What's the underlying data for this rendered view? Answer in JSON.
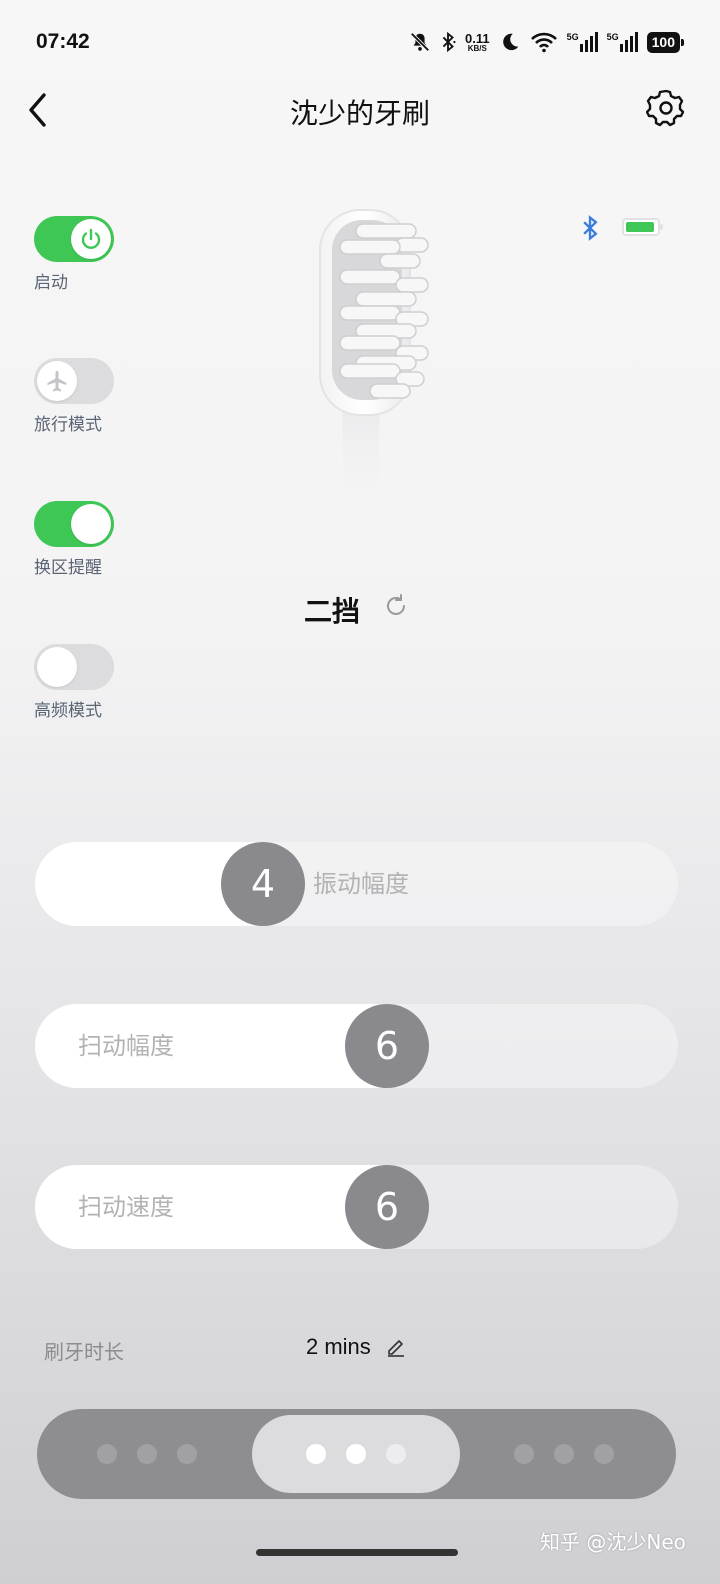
{
  "status_bar": {
    "time": "07:42",
    "net_speed_value": "0.11",
    "net_speed_unit": "KB/S",
    "sim1_label": "5G",
    "sim2_label": "5G",
    "battery": "100",
    "icons": [
      "mute-bell-icon",
      "bluetooth-icon",
      "moon-icon",
      "wifi-icon",
      "signal-icon",
      "battery-icon"
    ]
  },
  "header": {
    "title": "沈少的牙刷",
    "back_icon": "chevron-left-icon",
    "settings_icon": "gear-icon"
  },
  "toggles": [
    {
      "label": "启动",
      "state": "on",
      "icon": "power-icon"
    },
    {
      "label": "旅行模式",
      "state": "off",
      "icon": "airplane-icon"
    },
    {
      "label": "换区提醒",
      "state": "on"
    },
    {
      "label": "高频模式",
      "state": "off"
    }
  ],
  "device": {
    "bluetooth_color": "#3b7ddd",
    "battery_color": "#3ec754",
    "battery_level": 0.85
  },
  "mode": {
    "current": "二挡",
    "refresh_icon": "refresh-icon"
  },
  "sliders": [
    {
      "label": "振动幅度",
      "value": "4",
      "level": 0.36
    },
    {
      "label": "扫动幅度",
      "value": "6",
      "level": 0.6
    },
    {
      "label": "扫动速度",
      "value": "6",
      "level": 0.6
    }
  ],
  "duration": {
    "label": "刷牙时长",
    "value": "2 mins",
    "edit_icon": "pencil-icon"
  },
  "mode_selector": {
    "selected_index": 1,
    "groups": 3
  },
  "watermark": "知乎 @沈少Neo",
  "colors": {
    "accent_green": "#3ec754",
    "slider_thumb": "#8a8a8e",
    "selector_bg": "#8e8e92"
  }
}
